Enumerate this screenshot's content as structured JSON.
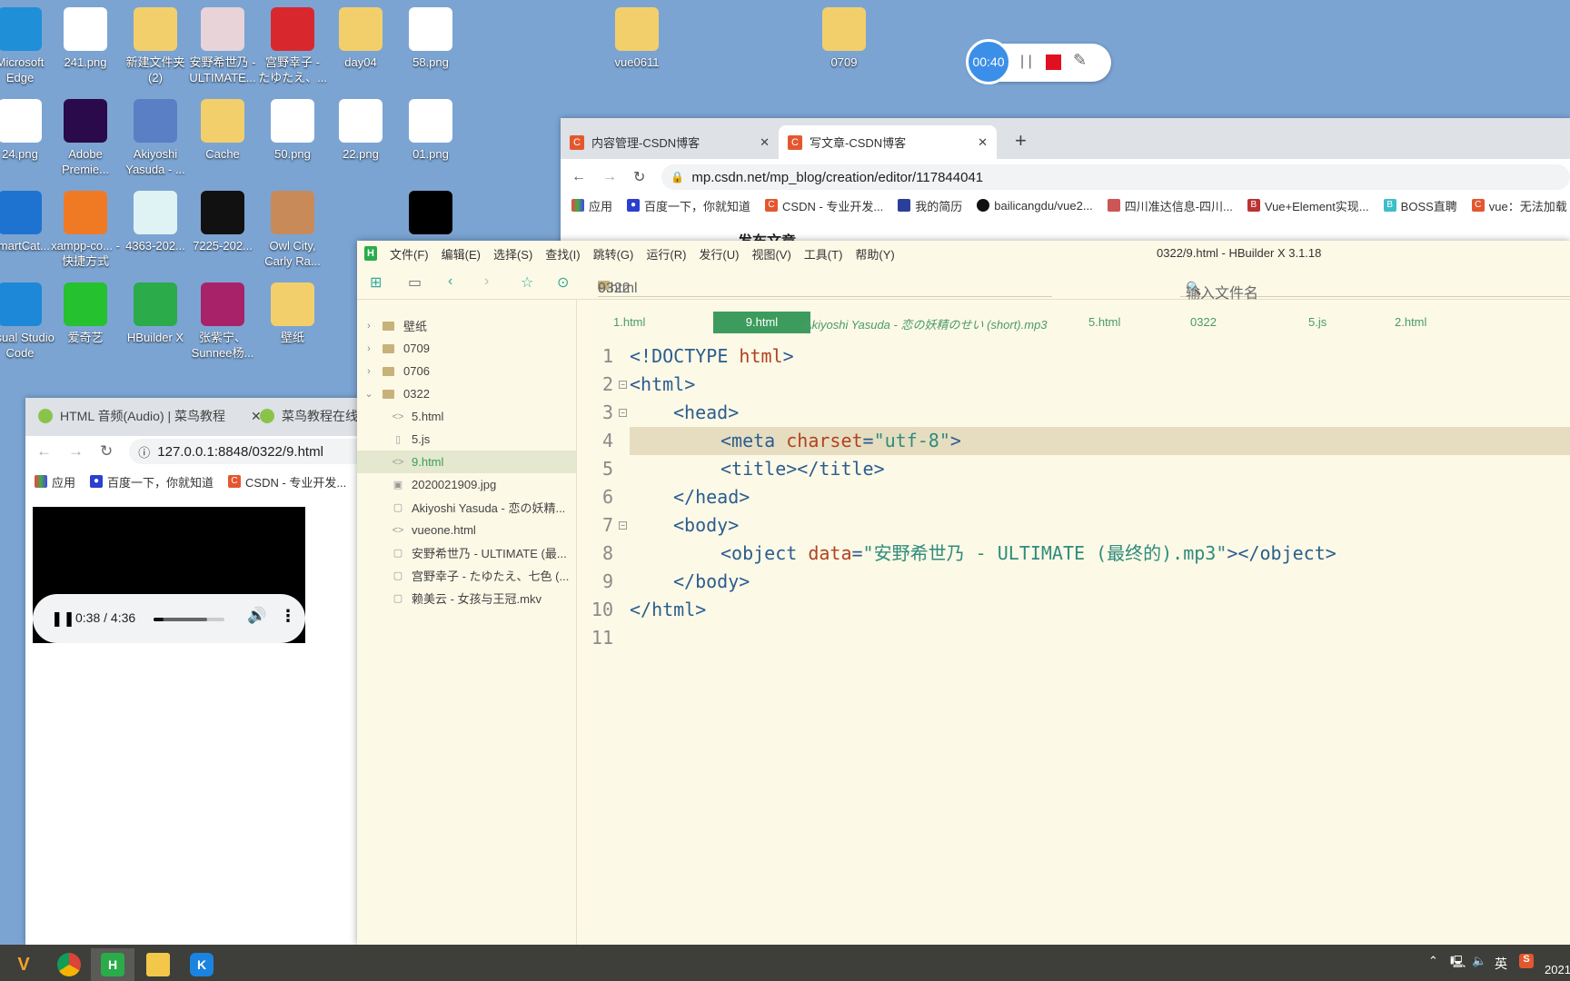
{
  "desktop": {
    "icons": [
      {
        "label": "Microsoft Edge",
        "color": "#1f8fd8"
      },
      {
        "label": "241.png",
        "color": "#ffffff"
      },
      {
        "label": "新建文件夹 (2)",
        "color": "#f3cf6b"
      },
      {
        "label": "安野希世乃 - ULTIMATE...",
        "color": "#e8d3d9"
      },
      {
        "label": "宫野幸子 - たゆたえ、...",
        "color": "#d9282d"
      },
      {
        "label": "day04",
        "color": "#f3cf6b"
      },
      {
        "label": "58.png",
        "color": "#ffffff"
      },
      {
        "label": "24.png",
        "color": "#ffffff"
      },
      {
        "label": "Adobe Premie...",
        "color": "#2a0a4a"
      },
      {
        "label": "Akiyoshi Yasuda - ...",
        "color": "#5a7fc4"
      },
      {
        "label": "Cache",
        "color": "#f3cf6b"
      },
      {
        "label": "50.png",
        "color": "#ffffff"
      },
      {
        "label": "22.png",
        "color": "#ffffff"
      },
      {
        "label": "01.png",
        "color": "#ffffff"
      },
      {
        "label": "SmartCat...",
        "color": "#1f73d0"
      },
      {
        "label": "xampp-co... - 快捷方式",
        "color": "#f07a24"
      },
      {
        "label": "4363-202...",
        "color": "#dff3f5"
      },
      {
        "label": "7225-202...",
        "color": "#111111"
      },
      {
        "label": "Owl City, Carly Ra...",
        "color": "#c98a5a"
      },
      {
        "label": "",
        "color": "#000000"
      },
      {
        "label": "Visual Studio Code",
        "color": "#1e88d8"
      },
      {
        "label": "爱奇艺",
        "color": "#25c12e"
      },
      {
        "label": "HBuilder X",
        "color": "#2bab4a"
      },
      {
        "label": "张紫宁、Sunnee杨...",
        "color": "#a8226a"
      },
      {
        "label": "壁纸",
        "color": "#f3cf6b"
      },
      {
        "label": "vue0611",
        "color": "#f3cf6b"
      },
      {
        "label": "0709",
        "color": "#f3cf6b"
      }
    ]
  },
  "recorder": {
    "time": "00:40",
    "pause": "| |"
  },
  "csdn_browser": {
    "tabs": [
      {
        "label": "内容管理-CSDN博客"
      },
      {
        "label": "写文章-CSDN博客"
      }
    ],
    "url": "mp.csdn.net/mp_blog/creation/editor/117844041",
    "bookmarks": [
      "应用",
      "百度一下，你就知道",
      "CSDN - 专业开发...",
      "我的简历",
      "bailicangdu/vue2...",
      "四川准达信息-四川...",
      "Vue+Element实现...",
      "BOSS直聘",
      "vue：无法加载"
    ],
    "page_heading": "发布文章"
  },
  "runoob_browser": {
    "tabs": [
      {
        "label": "HTML 音频(Audio) | 菜鸟教程"
      },
      {
        "label": "菜鸟教程在线编辑"
      }
    ],
    "url": "127.0.0.1:8848/0322/9.html",
    "bookmarks": [
      "应用",
      "百度一下，你就知道",
      "CSDN - 专业开发..."
    ],
    "player": {
      "time": "0:38 / 4:36",
      "progress": 0.138,
      "buffered": 0.75,
      "state": "playing"
    }
  },
  "hbuilder": {
    "title": "0322/9.html - HBuilder X 3.1.18",
    "menu": [
      "文件(F)",
      "编辑(E)",
      "选择(S)",
      "查找(I)",
      "跳转(G)",
      "运行(R)",
      "发行(U)",
      "视图(V)",
      "工具(T)",
      "帮助(Y)"
    ],
    "breadcrumb": [
      "0322",
      "9.html"
    ],
    "search_placeholder": "输入文件名",
    "tree": [
      {
        "label": "壁纸",
        "type": "folder",
        "expanded": false
      },
      {
        "label": "0709",
        "type": "folder",
        "expanded": false
      },
      {
        "label": "0706",
        "type": "folder",
        "expanded": false
      },
      {
        "label": "0322",
        "type": "folder",
        "expanded": true
      },
      {
        "label": "5.html",
        "type": "html"
      },
      {
        "label": "5.js",
        "type": "js"
      },
      {
        "label": "9.html",
        "type": "html",
        "selected": true
      },
      {
        "label": "2020021909.jpg",
        "type": "image"
      },
      {
        "label": "Akiyoshi Yasuda - 恋の妖精...",
        "type": "file"
      },
      {
        "label": "vueone.html",
        "type": "html"
      },
      {
        "label": "安野希世乃 - ULTIMATE (最...",
        "type": "file"
      },
      {
        "label": "宫野幸子 - たゆたえ、七色 (...",
        "type": "file"
      },
      {
        "label": "赖美云 - 女孩与王冠.mkv",
        "type": "file"
      }
    ],
    "editor_tabs": [
      "1.html",
      "9.html",
      "Akiyoshi Yasuda - 恋の妖精のせい (short).mp3",
      "5.html",
      "0322",
      "5.js",
      "2.html"
    ],
    "active_tab": "9.html",
    "line_numbers": [
      "1",
      "2",
      "3",
      "4",
      "5",
      "6",
      "7",
      "8",
      "9",
      "10",
      "11"
    ],
    "code": {
      "l1a": "<!DOCTYPE ",
      "l1b": "html",
      "l1c": ">",
      "l2": "<html>",
      "l3": "<head>",
      "l4a": "<meta ",
      "l4b": "charset",
      "l4c": "=",
      "l4d": "\"utf-8\"",
      "l4e": ">",
      "l5": "<title></title>",
      "l6": "</head>",
      "l7": "<body>",
      "l8a": "<object ",
      "l8b": "data",
      "l8c": "=",
      "l8d": "\"安野希世乃 - ULTIMATE (最终的).mp3\"",
      "l8e": "></object>",
      "l9": "</body>",
      "l10": "</html>"
    }
  },
  "taskbar": {
    "tray_lang": "英",
    "clock_year": "2021"
  },
  "colors": {
    "accent_green": "#3d9c5d",
    "desktop": "#7ba4d3",
    "editor_bg": "#fdf9e7"
  }
}
